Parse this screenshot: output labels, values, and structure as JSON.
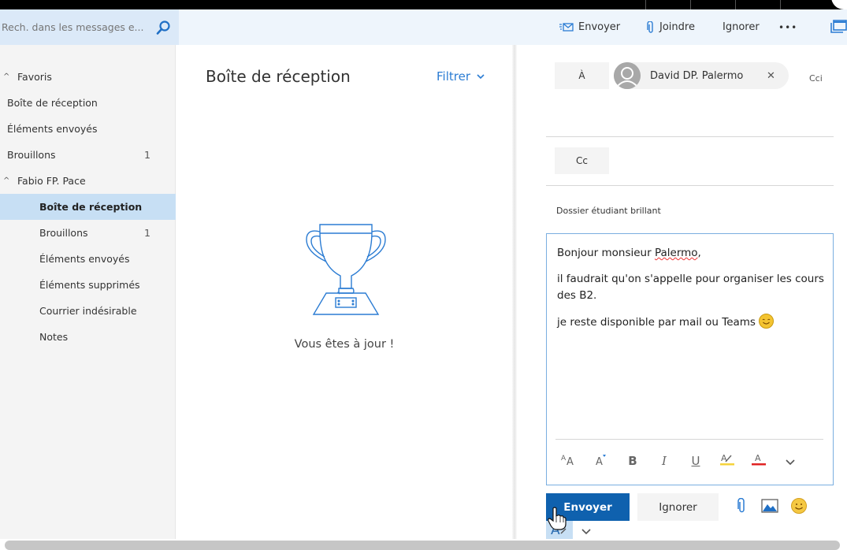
{
  "search": {
    "placeholder": "Rech. dans les messages e...",
    "icon": "search-icon"
  },
  "toolbar": {
    "send_label": "Envoyer",
    "attach_label": "Joindre",
    "discard_label": "Ignorer",
    "more_label": "•••",
    "popout_icon": "popout-icon"
  },
  "sidebar": {
    "groups": [
      {
        "label": "Favoris",
        "items": [
          {
            "label": "Boîte de réception",
            "count": ""
          },
          {
            "label": "Éléments envoyés",
            "count": ""
          },
          {
            "label": "Brouillons",
            "count": "1"
          }
        ]
      },
      {
        "label": "Fabio FP. Pace",
        "items": [
          {
            "label": "Boîte de réception",
            "count": "",
            "selected": true
          },
          {
            "label": "Brouillons",
            "count": "1"
          },
          {
            "label": "Éléments envoyés",
            "count": ""
          },
          {
            "label": "Éléments supprimés",
            "count": ""
          },
          {
            "label": "Courrier indésirable",
            "count": ""
          },
          {
            "label": "Notes",
            "count": ""
          }
        ]
      }
    ]
  },
  "message_list": {
    "title": "Boîte de réception",
    "filter_label": "Filtrer",
    "empty_text": "Vous êtes à jour !",
    "empty_icon": "trophy-icon"
  },
  "compose": {
    "to_label": "À",
    "recipients": [
      {
        "name": "David DP. Palermo"
      }
    ],
    "bcc_label": "Cci",
    "cc_label": "Cc",
    "subject": "Dossier étudiant brillant",
    "body": {
      "line1_before": "Bonjour monsieur ",
      "line1_misspelled": "Palermo",
      "line1_after": ",",
      "line2": "il faudrait qu'on s'appelle pour organiser les cours des B2.",
      "line3": "je reste disponible par mail ou Teams"
    },
    "format_tools": [
      "font-size",
      "grow-font",
      "bold",
      "italic",
      "underline",
      "highlight",
      "font-color",
      "more"
    ],
    "format_labels": {
      "bold": "B",
      "italic": "I",
      "underline": "U",
      "font_color": "A",
      "grow_font": "A"
    },
    "send_label": "Envoyer",
    "discard_label": "Ignorer"
  },
  "colors": {
    "accent": "#0f61ae",
    "link": "#2b7cd3",
    "selected_bg": "#c7dff4",
    "search_bg": "#dbe9f8",
    "toolbar_bg": "#eef5fc",
    "highlight_yellow": "#f5d33b",
    "font_color_red": "#e02424"
  }
}
